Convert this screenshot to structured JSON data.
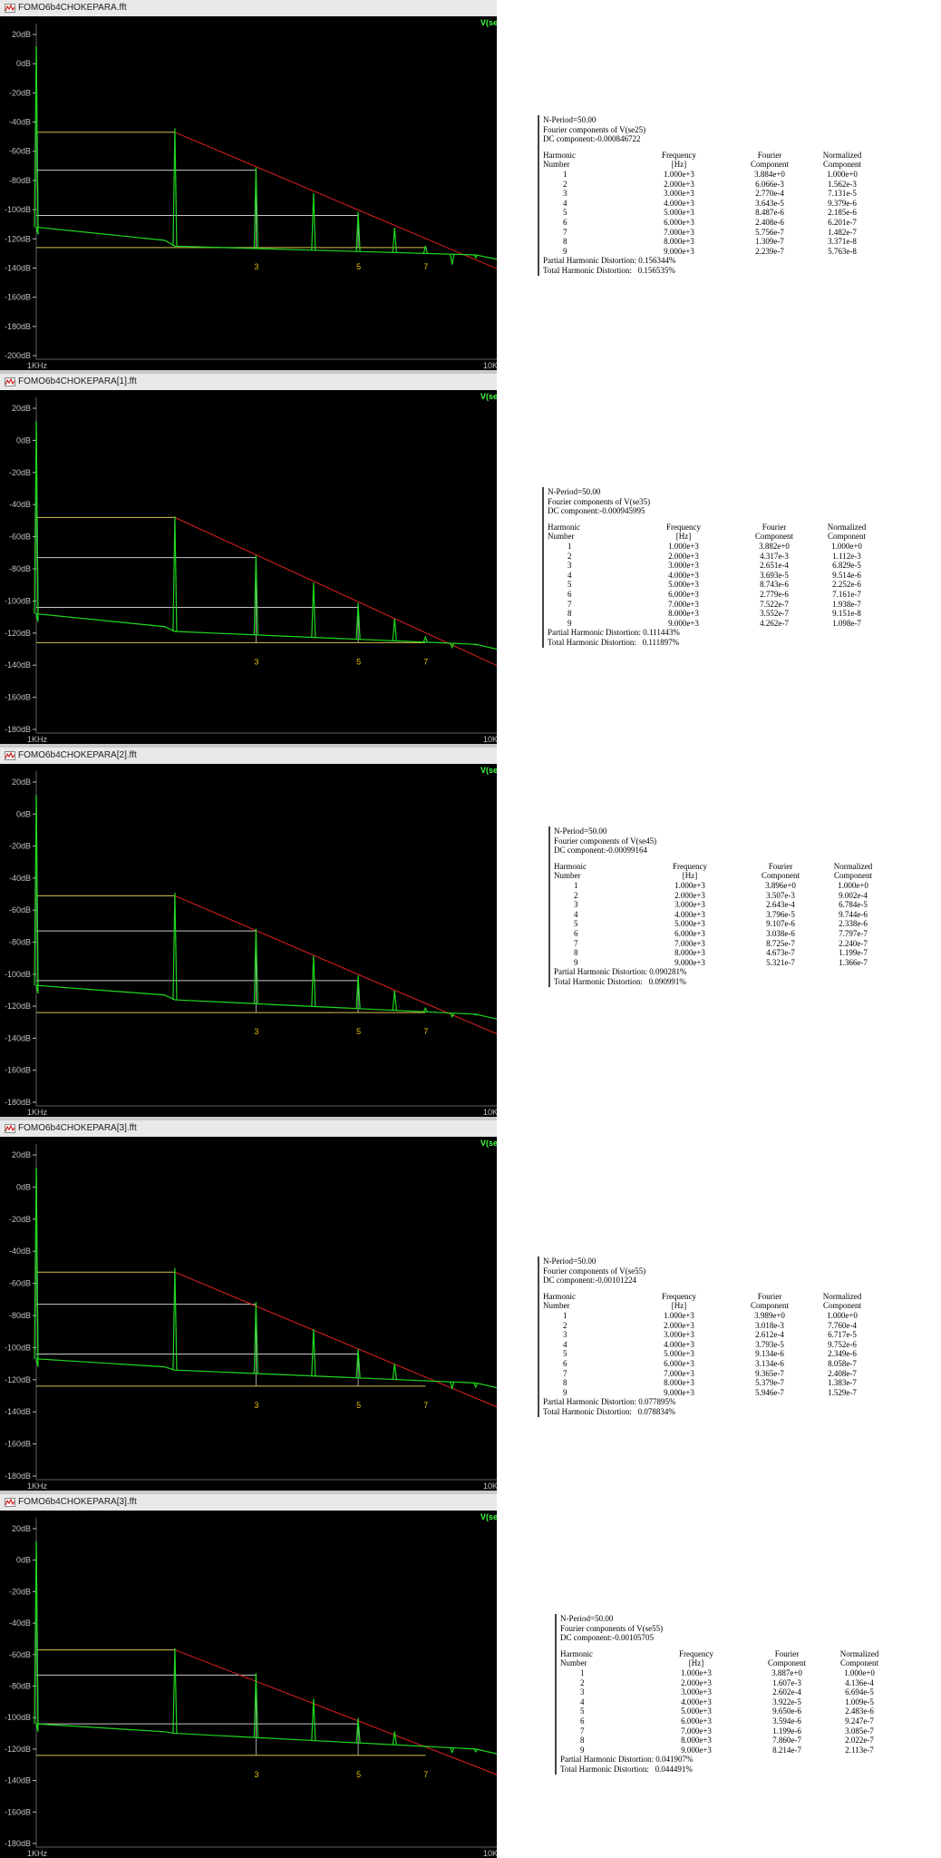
{
  "panels": [
    {
      "title": "FOMO6b4CHOKEPARA.fft",
      "trace_label": "V(se",
      "y_ticks": [
        "20dB",
        "0dB",
        "-20dB",
        "-40dB",
        "-60dB",
        "-80dB",
        "-100dB",
        "-120dB",
        "-140dB",
        "-160dB",
        "-180dB",
        "-200dB"
      ],
      "x_start": "1KHz",
      "x_end": "10K",
      "harmonic_markers": [
        "3",
        "5",
        "7"
      ],
      "report": {
        "n_period": "N-Period=50.00",
        "components_of": "Fourier components of V(se25)",
        "dc": "DC component:-0.000846722",
        "headers": [
          [
            "Harmonic",
            "Number"
          ],
          [
            "Frequency",
            "[Hz]"
          ],
          [
            "Fourier",
            "Component"
          ],
          [
            "Normalized",
            "Component"
          ]
        ],
        "rows": [
          [
            "1",
            "1.000e+3",
            "3.884e+0",
            "1.000e+0"
          ],
          [
            "2",
            "2.000e+3",
            "6.066e-3",
            "1.562e-3"
          ],
          [
            "3",
            "3.000e+3",
            "2.770e-4",
            "7.131e-5"
          ],
          [
            "4",
            "4.000e+3",
            "3.643e-5",
            "9.379e-6"
          ],
          [
            "5",
            "5.000e+3",
            "8.487e-6",
            "2.185e-6"
          ],
          [
            "6",
            "6.000e+3",
            "2.408e-6",
            "6.201e-7"
          ],
          [
            "7",
            "7.000e+3",
            "5.756e-7",
            "1.482e-7"
          ],
          [
            "8",
            "8.000e+3",
            "1.309e-7",
            "3.371e-8"
          ],
          [
            "9",
            "9.000e+3",
            "2.239e-7",
            "5.763e-8"
          ]
        ],
        "partial": "Partial Harmonic Distortion: 0.156344%",
        "total": "Total Harmonic Distortion:   0.156535%"
      }
    },
    {
      "title": "FOMO6b4CHOKEPARA[1].fft",
      "trace_label": "V(se",
      "y_ticks": [
        "20dB",
        "0dB",
        "-20dB",
        "-40dB",
        "-60dB",
        "-80dB",
        "-100dB",
        "-120dB",
        "-140dB",
        "-160dB",
        "-180dB"
      ],
      "x_start": "1KHz",
      "x_end": "10K",
      "harmonic_markers": [
        "3",
        "5",
        "7"
      ],
      "report": {
        "n_period": "N-Period=50.00",
        "components_of": "Fourier components of V(se35)",
        "dc": "DC component:-0.000945995",
        "headers": [
          [
            "Harmonic",
            "Number"
          ],
          [
            "Frequency",
            "[Hz]"
          ],
          [
            "Fourier",
            "Component"
          ],
          [
            "Normalized",
            "Component"
          ]
        ],
        "rows": [
          [
            "1",
            "1.000e+3",
            "3.882e+0",
            "1.000e+0"
          ],
          [
            "2",
            "2.000e+3",
            "4.317e-3",
            "1.112e-3"
          ],
          [
            "3",
            "3.000e+3",
            "2.651e-4",
            "6.829e-5"
          ],
          [
            "4",
            "4.000e+3",
            "3.693e-5",
            "9.514e-6"
          ],
          [
            "5",
            "5.000e+3",
            "8.743e-6",
            "2.252e-6"
          ],
          [
            "6",
            "6.000e+3",
            "2.779e-6",
            "7.161e-7"
          ],
          [
            "7",
            "7.000e+3",
            "7.522e-7",
            "1.938e-7"
          ],
          [
            "8",
            "8.000e+3",
            "3.552e-7",
            "9.151e-8"
          ],
          [
            "9",
            "9.000e+3",
            "4.262e-7",
            "1.098e-7"
          ]
        ],
        "partial": "Partial Harmonic Distortion: 0.111443%",
        "total": "Total Harmonic Distortion:   0.111897%"
      }
    },
    {
      "title": "FOMO6b4CHOKEPARA[2].fft",
      "trace_label": "V(se",
      "y_ticks": [
        "20dB",
        "0dB",
        "-20dB",
        "-40dB",
        "-60dB",
        "-80dB",
        "-100dB",
        "-120dB",
        "-140dB",
        "-160dB",
        "-180dB"
      ],
      "x_start": "1KHz",
      "x_end": "10K",
      "harmonic_markers": [
        "3",
        "5",
        "7"
      ],
      "report": {
        "n_period": "N-Period=50.00",
        "components_of": "Fourier components of V(se45)",
        "dc": "DC component:-0.00099164",
        "headers": [
          [
            "Harmonic",
            "Number"
          ],
          [
            "Frequency",
            "[Hz]"
          ],
          [
            "Fourier",
            "Component"
          ],
          [
            "Normalized",
            "Component"
          ]
        ],
        "rows": [
          [
            "1",
            "1.000e+3",
            "3.896e+0",
            "1.000e+0"
          ],
          [
            "2",
            "2.000e+3",
            "3.507e-3",
            "9.002e-4"
          ],
          [
            "3",
            "3.000e+3",
            "2.643e-4",
            "6.784e-5"
          ],
          [
            "4",
            "4.000e+3",
            "3.796e-5",
            "9.744e-6"
          ],
          [
            "5",
            "5.000e+3",
            "9.107e-6",
            "2.338e-6"
          ],
          [
            "6",
            "6.000e+3",
            "3.038e-6",
            "7.797e-7"
          ],
          [
            "7",
            "7.000e+3",
            "8.725e-7",
            "2.240e-7"
          ],
          [
            "8",
            "8.000e+3",
            "4.673e-7",
            "1.199e-7"
          ],
          [
            "9",
            "9.000e+3",
            "5.321e-7",
            "1.366e-7"
          ]
        ],
        "partial": "Partial Harmonic Distortion: 0.090281%",
        "total": "Total Harmonic Distortion:   0.090991%"
      }
    },
    {
      "title": "FOMO6b4CHOKEPARA[3].fft",
      "trace_label": "V(se",
      "y_ticks": [
        "20dB",
        "0dB",
        "-20dB",
        "-40dB",
        "-60dB",
        "-80dB",
        "-100dB",
        "-120dB",
        "-140dB",
        "-160dB",
        "-180dB"
      ],
      "x_start": "1KHz",
      "x_end": "10K",
      "harmonic_markers": [
        "3",
        "5",
        "7"
      ],
      "report": {
        "n_period": "N-Period=50.00",
        "components_of": "Fourier components of V(se55)",
        "dc": "DC component:-0.00101224",
        "headers": [
          [
            "Harmonic",
            "Number"
          ],
          [
            "Frequency",
            "[Hz]"
          ],
          [
            "Fourier",
            "Component"
          ],
          [
            "Normalized",
            "Component"
          ]
        ],
        "rows": [
          [
            "1",
            "1.000e+3",
            "3.989e+0",
            "1.000e+0"
          ],
          [
            "2",
            "2.000e+3",
            "3.018e-3",
            "7.760e-4"
          ],
          [
            "3",
            "3.000e+3",
            "2.612e-4",
            "6.717e-5"
          ],
          [
            "4",
            "4.000e+3",
            "3.793e-5",
            "9.752e-6"
          ],
          [
            "5",
            "5.000e+3",
            "9.134e-6",
            "2.349e-6"
          ],
          [
            "6",
            "6.000e+3",
            "3.134e-6",
            "8.058e-7"
          ],
          [
            "7",
            "7.000e+3",
            "9.365e-7",
            "2.408e-7"
          ],
          [
            "8",
            "8.000e+3",
            "5.379e-7",
            "1.383e-7"
          ],
          [
            "9",
            "9.000e+3",
            "5.946e-7",
            "1.529e-7"
          ]
        ],
        "partial": "Partial Harmonic Distortion: 0.077895%",
        "total": "Total Harmonic Distortion:   0.078834%"
      }
    },
    {
      "title": "FOMO6b4CHOKEPARA[3].fft",
      "trace_label": "V(se",
      "y_ticks": [
        "20dB",
        "0dB",
        "-20dB",
        "-40dB",
        "-60dB",
        "-80dB",
        "-100dB",
        "-120dB",
        "-140dB",
        "-160dB",
        "-180dB"
      ],
      "x_start": "1KHz",
      "x_end": "10K",
      "harmonic_markers": [
        "3",
        "5",
        "7"
      ],
      "report": {
        "n_period": "N-Period=50.00",
        "components_of": "Fourier components of V(se55)",
        "dc": "DC component:-0.00105705",
        "headers": [
          [
            "Harmonic",
            "Number"
          ],
          [
            "Frequency",
            "[Hz]"
          ],
          [
            "Fourier",
            "Component"
          ],
          [
            "Normalized",
            "Component"
          ]
        ],
        "rows": [
          [
            "1",
            "1.000e+3",
            "3.887e+0",
            "1.000e+0"
          ],
          [
            "2",
            "2.000e+3",
            "1.607e-3",
            "4.136e-4"
          ],
          [
            "3",
            "3.000e+3",
            "2.602e-4",
            "6.694e-5"
          ],
          [
            "4",
            "4.000e+3",
            "3.922e-5",
            "1.009e-5"
          ],
          [
            "5",
            "5.000e+3",
            "9.650e-6",
            "2.483e-6"
          ],
          [
            "6",
            "6.000e+3",
            "3.594e-6",
            "9.247e-7"
          ],
          [
            "7",
            "7.000e+3",
            "1.199e-6",
            "3.085e-7"
          ],
          [
            "8",
            "8.000e+3",
            "7.860e-7",
            "2.022e-7"
          ],
          [
            "9",
            "9.000e+3",
            "8.214e-7",
            "2.113e-7"
          ]
        ],
        "partial": "Partial Harmonic Distortion: 0.041907%",
        "total": "Total Harmonic Distortion:   0.044491%"
      }
    }
  ],
  "colors": {
    "plot_bg": "#000000",
    "trace": "#1ed81e",
    "slope_line": "#e02020",
    "level_yellow": "#d8c050",
    "level_white": "#c8c8c8",
    "tick_text": "#c0c0c0",
    "marker_text": "#e8c000",
    "label_green": "#40ff40"
  },
  "chart_data": [
    {
      "type": "line",
      "title": "FOMO6b4CHOKEPARA.fft",
      "xlabel": "",
      "ylabel": "",
      "x": [
        1000,
        2000,
        3000,
        4000,
        5000,
        6000,
        7000,
        8000,
        9000
      ],
      "series": [
        {
          "name": "V(se",
          "values": [
            11.79,
            -44.34,
            -71.15,
            -88.77,
            -101.42,
            -112.37,
            -124.8,
            -137.66,
            -133.0
          ]
        }
      ],
      "ylim": [
        -200,
        20
      ],
      "xlim": [
        1000,
        10000
      ],
      "x_scale": "log"
    },
    {
      "type": "line",
      "title": "FOMO6b4CHOKEPARA[1].fft",
      "xlabel": "",
      "ylabel": "",
      "x": [
        1000,
        2000,
        3000,
        4000,
        5000,
        6000,
        7000,
        8000,
        9000
      ],
      "series": [
        {
          "name": "V(se",
          "values": [
            11.78,
            -47.3,
            -71.53,
            -88.65,
            -101.17,
            -111.12,
            -122.47,
            -128.99,
            -127.41
          ]
        }
      ],
      "ylim": [
        -180,
        20
      ],
      "xlim": [
        1000,
        10000
      ],
      "x_scale": "log"
    },
    {
      "type": "line",
      "title": "FOMO6b4CHOKEPARA[2].fft",
      "xlabel": "",
      "ylabel": "",
      "x": [
        1000,
        2000,
        3000,
        4000,
        5000,
        6000,
        7000,
        8000,
        9000
      ],
      "series": [
        {
          "name": "V(se",
          "values": [
            11.81,
            -49.1,
            -71.56,
            -88.41,
            -100.81,
            -110.35,
            -121.18,
            -126.61,
            -125.48
          ]
        }
      ],
      "ylim": [
        -180,
        20
      ],
      "xlim": [
        1000,
        10000
      ],
      "x_scale": "log"
    },
    {
      "type": "line",
      "title": "FOMO6b4CHOKEPARA[3].fft",
      "xlabel": "",
      "ylabel": "",
      "x": [
        1000,
        2000,
        3000,
        4000,
        5000,
        6000,
        7000,
        8000,
        9000
      ],
      "series": [
        {
          "name": "V(se",
          "values": [
            12.02,
            -50.41,
            -71.66,
            -88.42,
            -100.79,
            -110.08,
            -120.57,
            -125.39,
            -124.52
          ]
        }
      ],
      "ylim": [
        -180,
        20
      ],
      "xlim": [
        1000,
        10000
      ],
      "x_scale": "log"
    },
    {
      "type": "line",
      "title": "FOMO6b4CHOKEPARA[3].fft",
      "xlabel": "",
      "ylabel": "",
      "x": [
        1000,
        2000,
        3000,
        4000,
        5000,
        6000,
        7000,
        8000,
        9000
      ],
      "series": [
        {
          "name": "V(se",
          "values": [
            11.79,
            -55.88,
            -71.7,
            -88.13,
            -100.31,
            -108.89,
            -118.42,
            -122.09,
            -121.71
          ]
        }
      ],
      "ylim": [
        -180,
        20
      ],
      "xlim": [
        1000,
        10000
      ],
      "x_scale": "log"
    }
  ]
}
